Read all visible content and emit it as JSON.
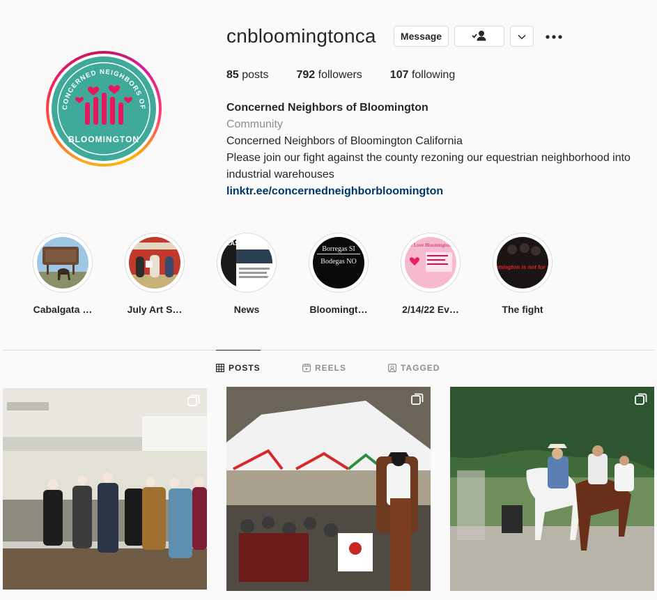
{
  "profile": {
    "username": "cnbloomingtonca",
    "logo_text_top": "CONCERNED NEIGHBORS OF",
    "logo_text_bottom": "BLOOMINGTON",
    "buttons": {
      "message": "Message"
    },
    "stats": {
      "posts_count": "85",
      "posts_label": "posts",
      "followers_count": "792",
      "followers_label": "followers",
      "following_count": "107",
      "following_label": "following"
    },
    "bio": {
      "name": "Concerned Neighbors of Bloomington",
      "category": "Community",
      "line1": "Concerned Neighbors of Bloomington California",
      "line2": "Please join our fight against the county rezoning our equestrian neighborhood into industrial warehouses",
      "link": "linktr.ee/concernedneighborbloomington"
    }
  },
  "highlights": [
    {
      "label": "Cabalgata …"
    },
    {
      "label": "July Art S…"
    },
    {
      "label": "News"
    },
    {
      "label": "Bloomingt…"
    },
    {
      "label": "2/14/22 Ev…"
    },
    {
      "label": "The fight"
    }
  ],
  "highlight_texts": {
    "bodegas_1": "Borregas SI",
    "bodegas_2": "Bodegas NO",
    "fight": "Bloomington is not for sale!",
    "news": "LEASE READ",
    "valentine": "We Love Bloomington"
  },
  "tabs": [
    {
      "label": "POSTS",
      "active": true
    },
    {
      "label": "REELS",
      "active": false
    },
    {
      "label": "TAGGED",
      "active": false
    }
  ],
  "colors": {
    "logo_teal": "#3fa99a",
    "accent_link": "#00376b",
    "logo_hands": "#e8175d"
  }
}
